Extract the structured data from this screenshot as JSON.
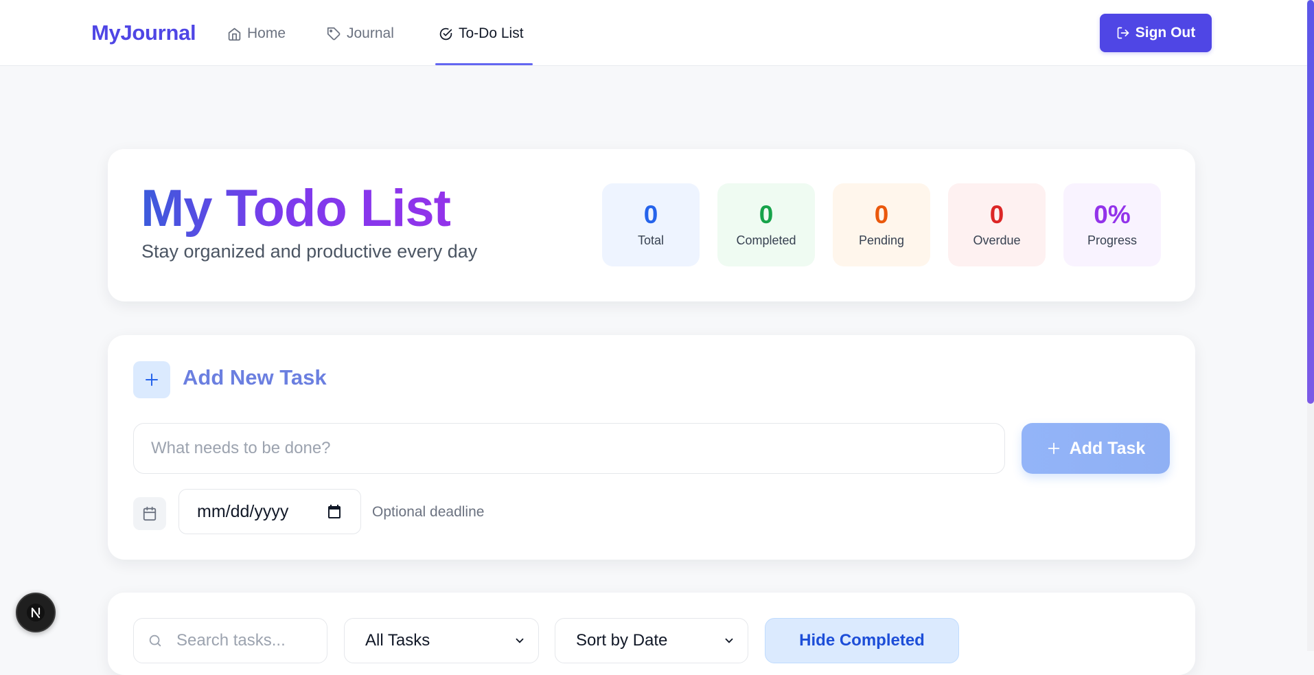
{
  "nav": {
    "brand": "MyJournal",
    "links": [
      {
        "label": "Home",
        "icon": "home-icon"
      },
      {
        "label": "Journal",
        "icon": "tag-icon"
      },
      {
        "label": "To-Do List",
        "icon": "check-circle-icon",
        "active": true
      }
    ],
    "sign_out": "Sign Out"
  },
  "hero": {
    "title": "My Todo List",
    "subtitle": "Stay organized and productive every day",
    "stats": [
      {
        "value": "0",
        "label": "Total",
        "color": "#2563eb",
        "bg": "#eef4ff"
      },
      {
        "value": "0",
        "label": "Completed",
        "color": "#16a34a",
        "bg": "#effbf2"
      },
      {
        "value": "0",
        "label": "Pending",
        "color": "#ea580c",
        "bg": "#fff6ec"
      },
      {
        "value": "0",
        "label": "Overdue",
        "color": "#dc2626",
        "bg": "#fef1f1"
      },
      {
        "value": "0%",
        "label": "Progress",
        "color": "#9333ea",
        "bg": "#f9f3ff"
      }
    ]
  },
  "add_task": {
    "title": "Add New Task",
    "placeholder": "What needs to be done?",
    "button": "Add Task",
    "date_placeholder": "mm/dd/yyyy",
    "deadline_hint": "Optional deadline"
  },
  "filters": {
    "search_placeholder": "Search tasks...",
    "status_value": "All Tasks",
    "sort_value": "Sort by Date",
    "hide_completed": "Hide Completed"
  },
  "colors": {
    "accent": "#4f46e5",
    "underline": "#6366f1"
  }
}
